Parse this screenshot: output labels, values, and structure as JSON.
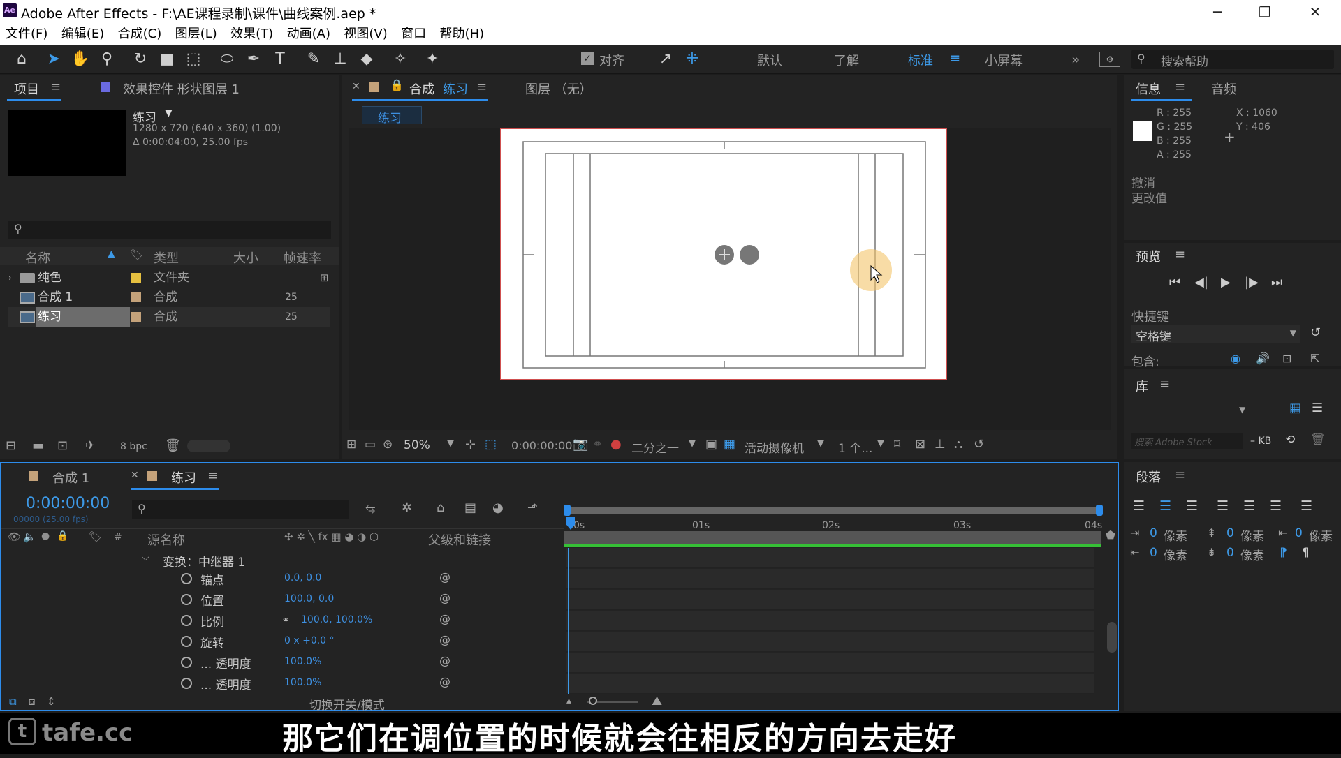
{
  "window": {
    "app_logo": "Ae",
    "title": "Adobe After Effects - F:\\AE课程录制\\课件\\曲线案例.aep *"
  },
  "menu": [
    "文件(F)",
    "编辑(E)",
    "合成(C)",
    "图层(L)",
    "效果(T)",
    "动画(A)",
    "视图(V)",
    "窗口",
    "帮助(H)"
  ],
  "toolbar": {
    "snap_label": "对齐",
    "workspaces": [
      "默认",
      "了解",
      "标准",
      "小屏幕"
    ],
    "active_workspace": "标准",
    "search_placeholder": "搜索帮助"
  },
  "project_panel": {
    "tab_project": "项目",
    "tab_effect_controls": "效果控件 形状图层 1",
    "comp_name": "练习",
    "comp_info1": "1280 x 720  (640 x 360) (1.00)",
    "comp_info2": "Δ 0:00:04:00, 25.00 fps",
    "columns": {
      "name": "名称",
      "type": "类型",
      "size": "大小",
      "fps": "帧速率"
    },
    "items": [
      {
        "name": "纯色",
        "type": "文件夹",
        "fps": ""
      },
      {
        "name": "合成 1",
        "type": "合成",
        "fps": "25"
      },
      {
        "name": "练习",
        "type": "合成",
        "fps": "25"
      }
    ],
    "bpc": "8 bpc"
  },
  "comp_panel": {
    "tab_comp_prefix": "合成",
    "tab_comp_name": "练习",
    "tab_layer": "图层 （无）",
    "breadcrumb": "练习",
    "zoom": "50%",
    "timecode": "0:00:00:00",
    "resolution": "二分之一",
    "camera": "活动摄像机",
    "views": "1 个..."
  },
  "info_panel": {
    "tab_info": "信息",
    "tab_audio": "音频",
    "r": "R : 255",
    "g": "G : 255",
    "b": "B : 255",
    "a": "A : 255",
    "x": "X : 1060",
    "y": "Y : 406",
    "undo1": "撤消",
    "undo2": "更改值"
  },
  "preview_panel": {
    "title": "预览",
    "shortcut_label": "快捷键",
    "shortcut_value": "空格键",
    "include_label": "包含:"
  },
  "library_panel": {
    "title": "库",
    "search_placeholder": "搜索 Adobe Stock",
    "kb": "– KB"
  },
  "paragraph_panel": {
    "title": "段落",
    "indent_values": [
      "0 像素",
      "0 像素",
      "0 像素",
      "0 像素",
      "0 像素"
    ]
  },
  "timeline": {
    "tab1": "合成 1",
    "tab2": "练习",
    "timecode": "0:00:00:00",
    "frame_info": "00000 (25.00 fps)",
    "col_source": "源名称",
    "col_parent": "父级和链接",
    "ruler": [
      "0s",
      "01s",
      "02s",
      "03s",
      "04s"
    ],
    "group": "变换：中继器 1",
    "props": [
      {
        "label": "锚点",
        "value": "0.0, 0.0"
      },
      {
        "label": "位置",
        "value": "100.0, 0.0"
      },
      {
        "label": "比例",
        "value": "100.0, 100.0%"
      },
      {
        "label": "旋转",
        "value": "0 x +0.0 °"
      },
      {
        "label": "... 透明度",
        "value": "100.0%"
      },
      {
        "label": "... 透明度",
        "value": "100.0%"
      }
    ],
    "toggle_modes": "切换开关/模式"
  },
  "subtitle": "那它们在调位置的时候就会往相反的方向去走好",
  "watermark": "tafe.cc",
  "colors": {
    "accent": "#2d8ceb",
    "timecode": "#3d9ae8",
    "label_yellow": "#e6c040",
    "label_tan": "#c4a27a"
  }
}
